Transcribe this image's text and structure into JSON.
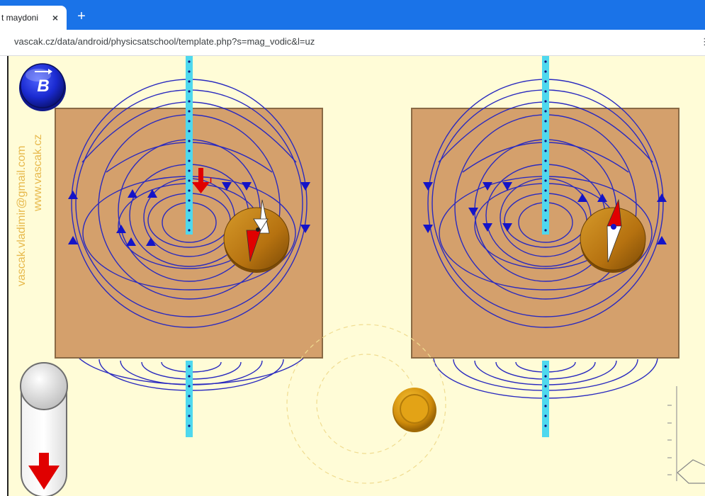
{
  "browser": {
    "tab_title": "t maydoni",
    "tab_close": "×",
    "new_tab": "+",
    "url": "vascak.cz/data/android/physicsatschool/template.php?s=mag_vodic&l=uz",
    "menu_hint": "⋮"
  },
  "app": {
    "b_button_label": "B",
    "current_label": "I",
    "credit_email": "vascak.vladimir@gmail.com",
    "credit_web": "www.vascak.cz"
  },
  "colors": {
    "background": "#fffcd7",
    "board": "#d4a06c",
    "field_lines": "#2a2abf",
    "wire": "#4fd8ee",
    "compass": "#c88a10",
    "needle_north": "#e00000",
    "credit_text": "#e7b94c",
    "tab_bar": "#1a73e8"
  },
  "icons": {
    "b_button": "magnetic-field-b-icon",
    "current_direction": "arrow-down-icon",
    "switch_direction": "arrow-down-icon"
  }
}
